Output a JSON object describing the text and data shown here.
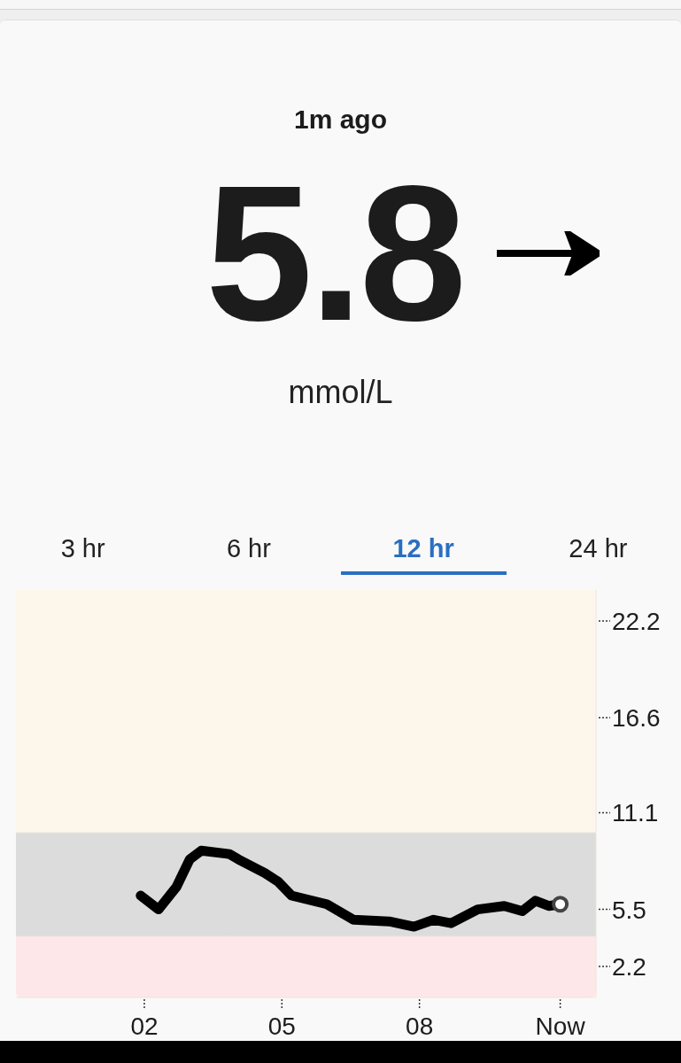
{
  "reading": {
    "age": "1m ago",
    "value": "5.8",
    "unit": "mmol/L"
  },
  "tabs": [
    {
      "label": "3 hr",
      "selected": false
    },
    {
      "label": "6 hr",
      "selected": false
    },
    {
      "label": "12 hr",
      "selected": true
    },
    {
      "label": "24 hr",
      "selected": false
    }
  ],
  "chart_data": {
    "type": "line",
    "x": [
      1.92,
      2.31,
      2.7,
      2.99,
      3.24,
      3.86,
      4.05,
      4.63,
      4.92,
      5.21,
      5.98,
      6.56,
      7.34,
      7.88,
      8.31,
      8.69,
      9.27,
      9.85,
      10.24,
      10.53,
      10.82,
      11.07
    ],
    "series": [
      {
        "color": "#000000",
        "values": [
          6.3,
          5.5,
          6.8,
          8.4,
          8.9,
          8.7,
          8.4,
          7.6,
          7.1,
          6.3,
          5.8,
          4.9,
          4.8,
          4.5,
          4.9,
          4.7,
          5.5,
          5.7,
          5.4,
          6.0,
          5.7,
          5.8
        ]
      }
    ],
    "xlim": [
      -0.8,
      11.85
    ],
    "ylim": [
      0.4,
      24
    ],
    "xticks": [
      {
        "value": 2,
        "label": "02"
      },
      {
        "value": 5,
        "label": "05"
      },
      {
        "value": 8,
        "label": "08"
      },
      {
        "value": 11.07,
        "label": "Now"
      }
    ],
    "yticks": [
      {
        "value": 22.2,
        "label": "22.2"
      },
      {
        "value": 16.6,
        "label": "16.6"
      },
      {
        "value": 11.1,
        "label": "11.1"
      },
      {
        "value": 5.5,
        "label": "5.5"
      },
      {
        "value": 2.2,
        "label": "2.2"
      }
    ]
  }
}
